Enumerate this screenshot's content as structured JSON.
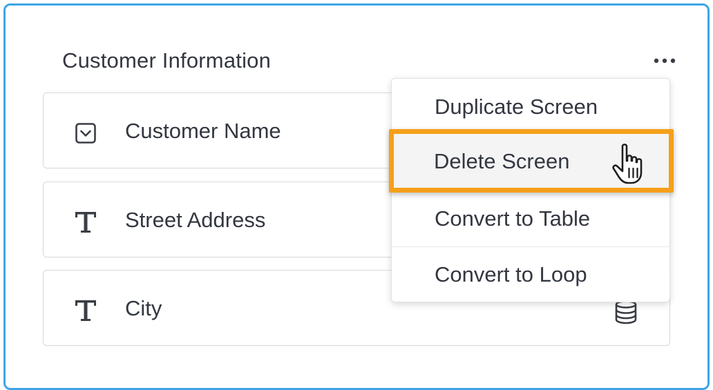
{
  "card": {
    "title": "Customer Information",
    "more_icon": "ellipsis-icon"
  },
  "fields": [
    {
      "label": "Customer Name",
      "icon": "checkbox-dropdown-icon"
    },
    {
      "label": "Street Address",
      "icon": "text-type-icon"
    },
    {
      "label": "City",
      "icon": "text-type-icon",
      "trailing_icon": "database-icon"
    }
  ],
  "menu": {
    "items": [
      {
        "label": "Duplicate Screen"
      },
      {
        "label": "Delete Screen",
        "highlighted": true
      },
      {
        "label": "Convert to Table"
      },
      {
        "label": "Convert to Loop"
      }
    ]
  },
  "colors": {
    "card_border": "#3da4e6",
    "highlight": "#f5a01a",
    "text": "#333740"
  }
}
